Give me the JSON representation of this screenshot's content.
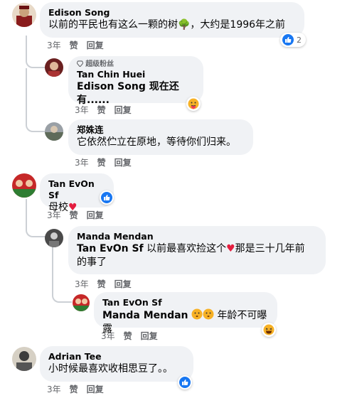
{
  "comments": [
    {
      "author": "Edison Song",
      "text": "以前的平民也有这么一颗的树🌳，大约是1996年之前",
      "age": "3年",
      "like_label": "赞",
      "reply_label": "回复",
      "reaction_count": "2"
    },
    {
      "badge": "超级粉丝",
      "author": "Tan Chin Huei",
      "text": "Edison Song 现在还有......",
      "age": "3年",
      "like_label": "赞",
      "reply_label": "回复"
    },
    {
      "author": "郑姝连",
      "text": "它依然伫立在原地，等待你们归来。",
      "age": "3年",
      "like_label": "赞",
      "reply_label": "回复"
    },
    {
      "author": "Tan EvOn Sf",
      "text": "母校",
      "age": "3年",
      "like_label": "赞",
      "reply_label": "回复"
    },
    {
      "author": "Manda Mendan",
      "mention": "Tan EvOn Sf",
      "text_a": " 以前最喜欢捡这个",
      "text_b": "那是三十几年前",
      "text_c": "的事了",
      "age": "3年",
      "like_label": "赞",
      "reply_label": "回复"
    },
    {
      "author": "Tan EvOn Sf",
      "mention": "Manda Mendan",
      "text": "年龄不可曝露",
      "age": "3年",
      "like_label": "赞",
      "reply_label": "回复"
    },
    {
      "author": "Adrian Tee",
      "text": "小时候最喜欢收相思豆了。。",
      "age": "3年",
      "like_label": "赞",
      "reply_label": "回复"
    }
  ],
  "colors": {
    "like_blue": "#1877f2",
    "heart_red": "#e41e3f",
    "bubble_bg": "#f0f2f5"
  }
}
